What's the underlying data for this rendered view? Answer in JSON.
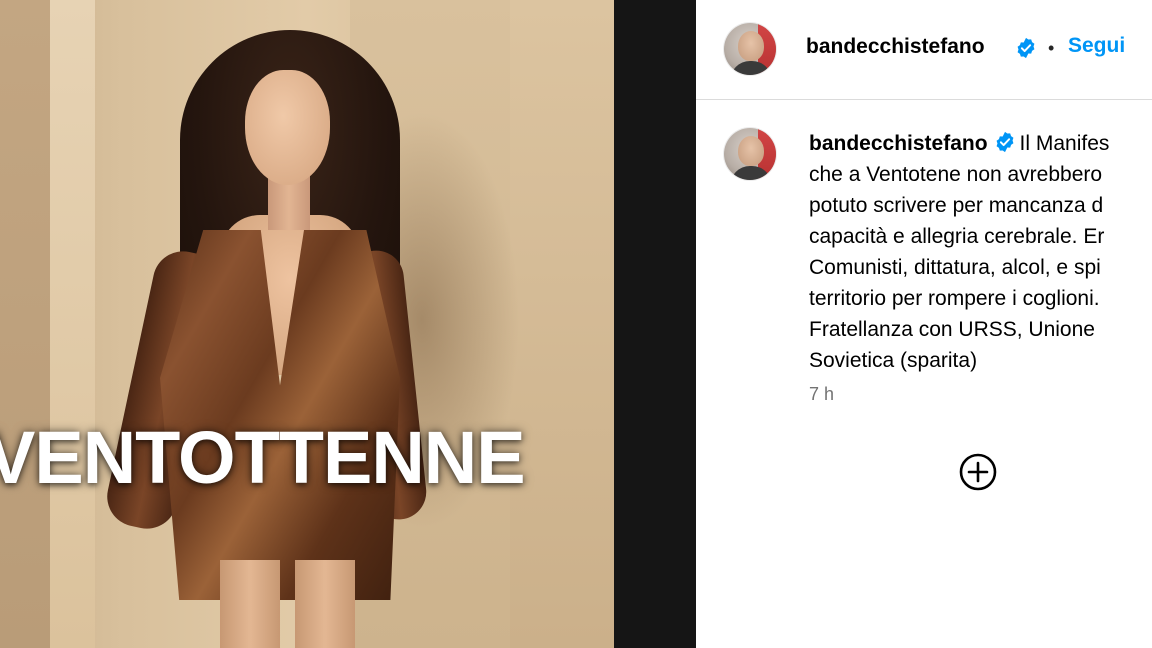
{
  "post_image": {
    "overlay_text": "VENTOTTENNE"
  },
  "header": {
    "username": "bandecchistefano",
    "verified": true,
    "separator": "•",
    "follow_label": "Segui"
  },
  "caption": {
    "username": "bandecchistefano",
    "verified": true,
    "lines": [
      "Il Manifes",
      "che a Ventotene non avrebbero",
      "potuto scrivere per mancanza d",
      "capacità e allegria cerebrale. Er",
      "Comunisti, dittatura, alcol, e spi",
      "territorio per rompere i coglioni.",
      "Fratellanza con URSS, Unione",
      "Sovietica (sparita)"
    ],
    "timestamp": "7 h"
  },
  "icons": {
    "verified": "verified-badge-icon",
    "add_comment": "plus-circle-icon"
  },
  "colors": {
    "link_blue": "#0095f6",
    "verified_blue": "#0095f6",
    "muted_text": "#737373",
    "divider": "#dbdbdb",
    "gap_dark": "#151515"
  }
}
